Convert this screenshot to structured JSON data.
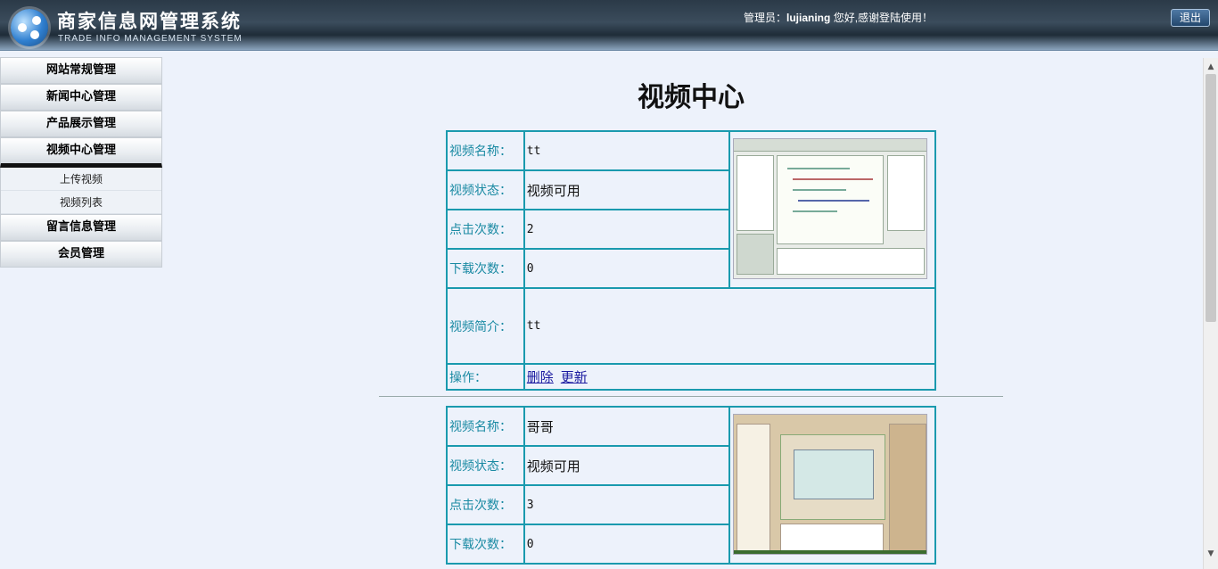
{
  "header": {
    "title_cn": "商家信息网管理系统",
    "title_en": "TRADE INFO MANAGEMENT SYSTEM",
    "welcome_prefix": "管理员：",
    "username": "lujianing",
    "welcome_suffix": " 您好,感谢登陆使用！",
    "logout_label": "退出"
  },
  "sidebar": {
    "items": [
      {
        "label": "网站常规管理"
      },
      {
        "label": "新闻中心管理"
      },
      {
        "label": "产品展示管理"
      },
      {
        "label": "视频中心管理"
      },
      {
        "label": "留言信息管理"
      },
      {
        "label": "会员管理"
      }
    ],
    "submenu": [
      {
        "label": "上传视频"
      },
      {
        "label": "视频列表"
      }
    ]
  },
  "main": {
    "title": "视频中心",
    "labels": {
      "name": "视频名称：",
      "status": "视频状态：",
      "clicks": "点击次数：",
      "downloads": "下载次数：",
      "intro": "视频简介：",
      "ops": "操作："
    },
    "actions": {
      "delete": "删除",
      "update": "更新"
    },
    "videos": [
      {
        "name": "tt",
        "status": "视频可用",
        "clicks": "2",
        "downloads": "0",
        "intro": "tt"
      },
      {
        "name": "哥哥",
        "status": "视频可用",
        "clicks": "3",
        "downloads": "0"
      }
    ]
  },
  "icons": {
    "logo": "logo-icon",
    "scroll_up": "scroll-up-arrow",
    "scroll_down": "scroll-down-arrow"
  },
  "colors": {
    "accent": "#1a9aae",
    "background": "#edf2fb",
    "header": "#2b3a48"
  }
}
